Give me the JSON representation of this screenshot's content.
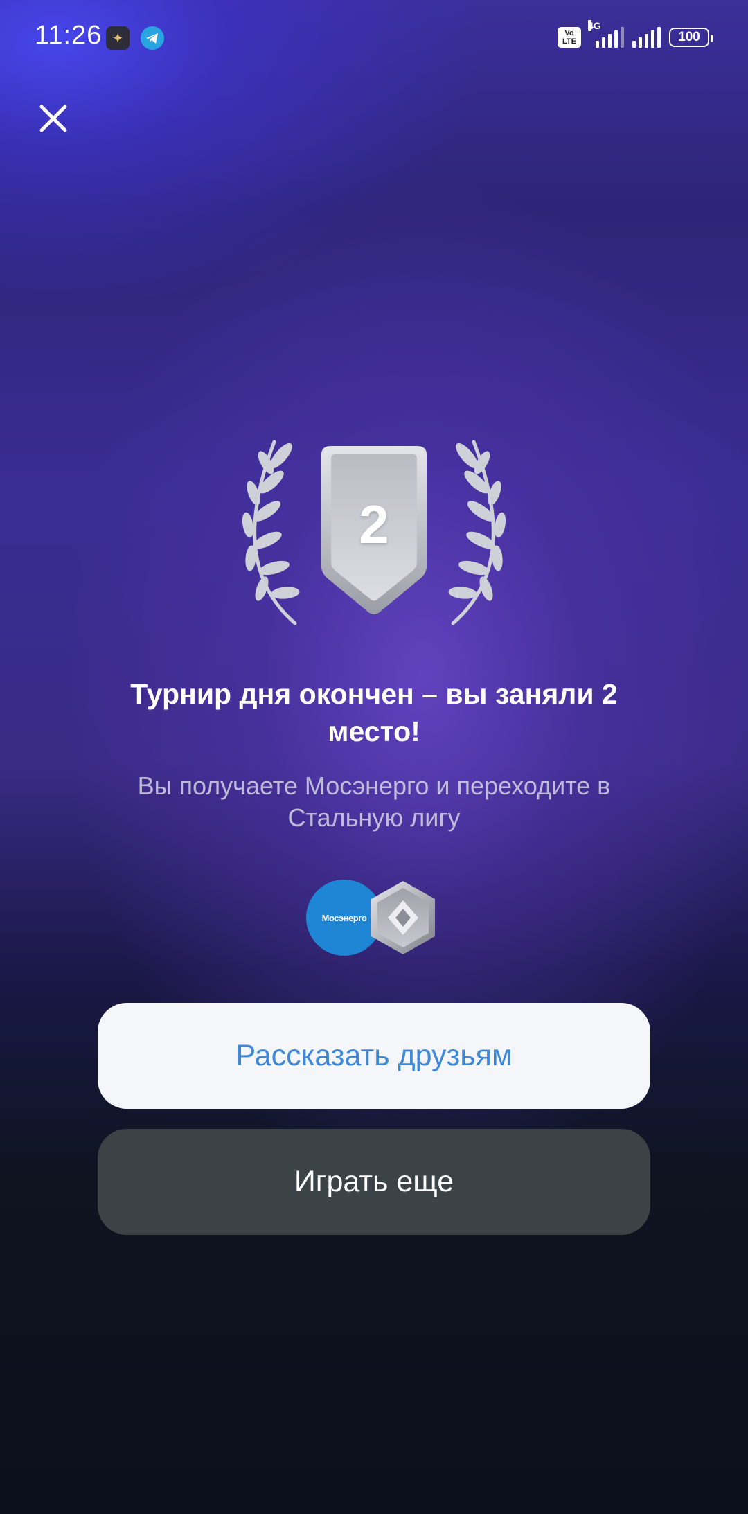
{
  "status_bar": {
    "time": "11:26",
    "network": "4G",
    "volte_top": "Vo",
    "volte_bottom": "LTE",
    "battery": "100",
    "icons": [
      "app-notification-icon",
      "telegram-icon",
      "volte-icon",
      "signal-icon",
      "signal-icon",
      "battery-icon"
    ]
  },
  "close_icon": "close-icon",
  "result": {
    "place": "2",
    "title": "Турнир дня окончен – вы заняли 2 место!",
    "subtitle": "Вы получаете Мосэнерго и переходите в Стальную лигу"
  },
  "rewards": {
    "company_logo_text": "Мосэнерго",
    "company_color": "#1e86d4",
    "league_icon": "steel-league-icon"
  },
  "buttons": {
    "share_label": "Рассказать друзьям",
    "play_label": "Играть еще"
  },
  "colors": {
    "accent_blue": "#3f88d8",
    "primary_button_bg": "#f4f6f9",
    "secondary_button_bg": "#3c4346",
    "silver": "#c9ccd3"
  }
}
